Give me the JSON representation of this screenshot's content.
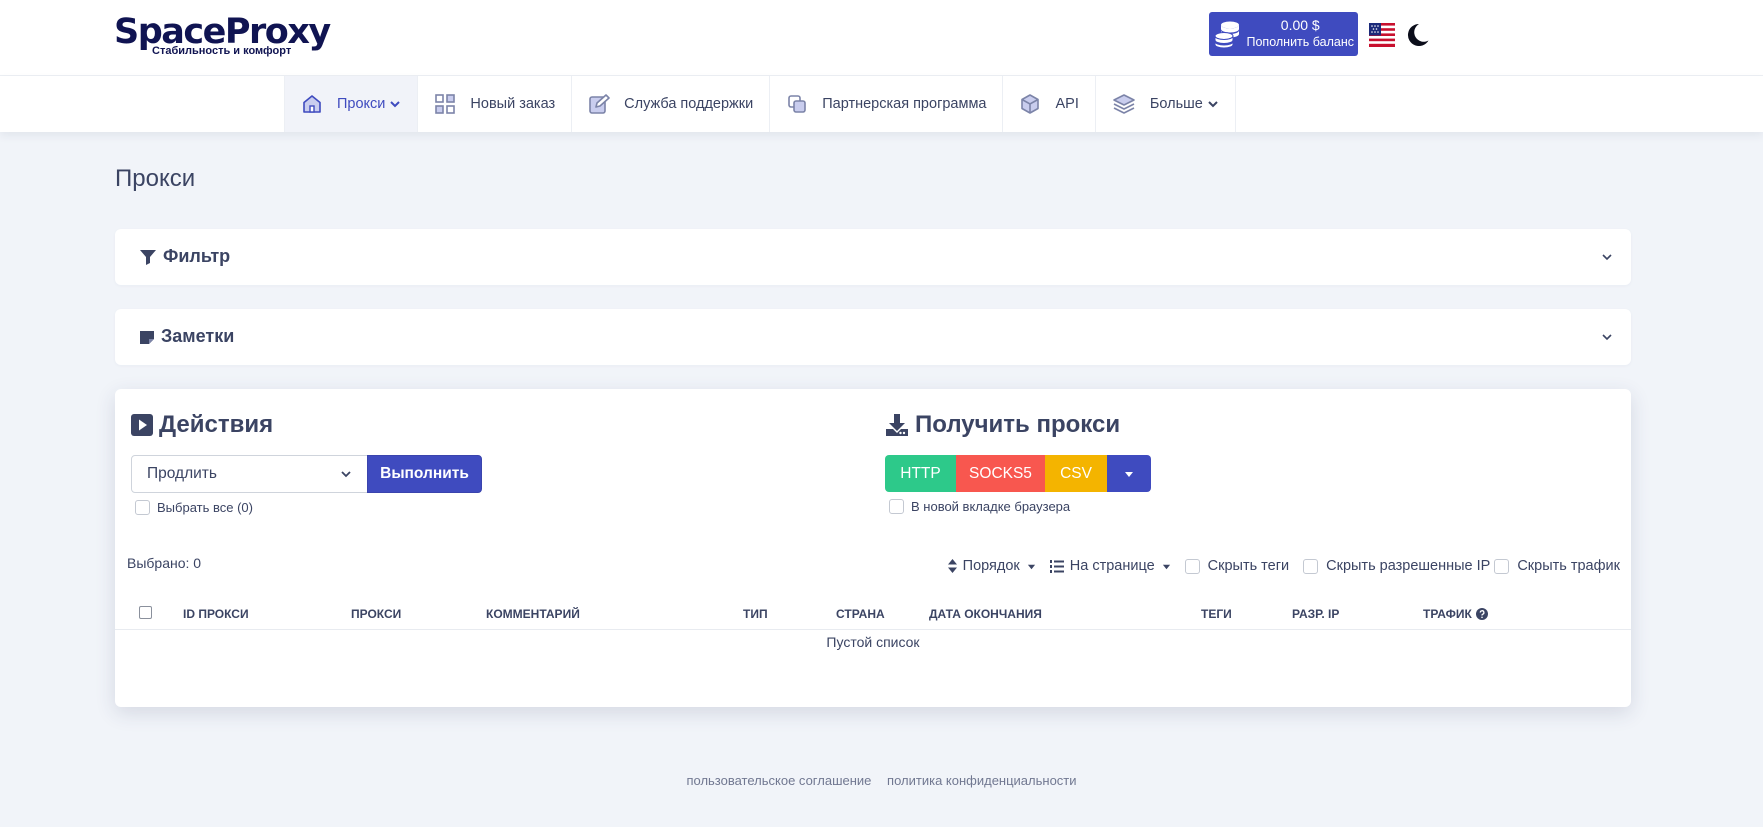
{
  "brand": {
    "name": "SpaceProxy",
    "tagline": "Стабильность и комфорт"
  },
  "header": {
    "balance_amount": "0.00 $",
    "balance_label": "Пополнить баланс",
    "flag_icon": "us-flag-icon",
    "theme_icon": "moon-icon"
  },
  "nav": {
    "items": [
      {
        "label": "Прокси",
        "icon": "home-icon",
        "active": true
      },
      {
        "label": "Новый заказ",
        "icon": "grid-icon"
      },
      {
        "label": "Служба поддержки",
        "icon": "edit-icon"
      },
      {
        "label": "Партнерская программа",
        "icon": "copy-icon"
      },
      {
        "label": "API",
        "icon": "cube-icon"
      },
      {
        "label": "Больше",
        "icon": "layers-icon"
      }
    ]
  },
  "page": {
    "title": "Прокси"
  },
  "filter": {
    "title": "Фильтр"
  },
  "notes": {
    "title": "Заметки"
  },
  "actions": {
    "title": "Действия",
    "select_value": "Продлить",
    "execute_label": "Выполнить",
    "select_all_label": "Выбрать все (0)"
  },
  "get_proxy": {
    "title": "Получить прокси",
    "formats": {
      "http": "HTTP",
      "socks5": "SOCKS5",
      "csv": "CSV"
    },
    "new_tab_label": "В новой вкладке браузера"
  },
  "table": {
    "selected": "Выбрано: 0",
    "toolbar": {
      "order": "Порядок",
      "per_page": "На странице",
      "hide_tags": "Скрыть теги",
      "hide_ip": "Скрыть разрешенные IP",
      "hide_traffic": "Скрыть трафик"
    },
    "columns": [
      "ID ПРОКСИ",
      "ПРОКСИ",
      "КОММЕНТАРИЙ",
      "ТИП",
      "СТРАНА",
      "ДАТА ОКОНЧАНИЯ",
      "ТЕГИ",
      "РАЗР. IP",
      "ТРАФИК"
    ],
    "empty": "Пустой список"
  },
  "footer": {
    "terms": "пользовательское соглашение",
    "privacy": "политика конфиденциальности"
  },
  "colors": {
    "primary": "#3f4bbf",
    "http": "#2dc98a",
    "socks5": "#f8574f",
    "csv": "#f4b400",
    "text": "#3b4463",
    "page_bg": "#f1f4f9"
  }
}
